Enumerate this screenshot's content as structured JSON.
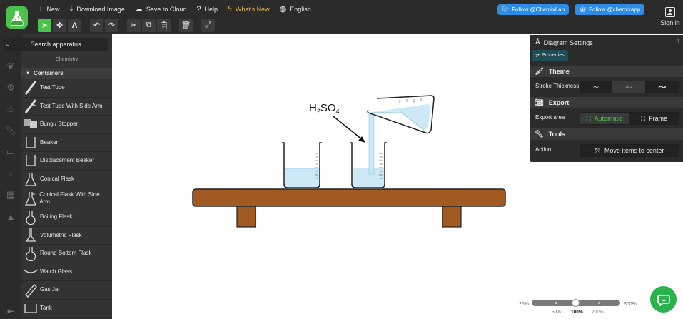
{
  "topbar": {
    "menu": [
      {
        "icon": "plus-icon",
        "label": "New"
      },
      {
        "icon": "download-icon",
        "label": "Download Image"
      },
      {
        "icon": "cloud-icon",
        "label": "Save to Cloud"
      },
      {
        "icon": "help-icon",
        "label": "Help"
      },
      {
        "icon": "bolt-icon",
        "label": "What's New"
      },
      {
        "icon": "globe-icon",
        "label": "English"
      }
    ],
    "follow_lab": "Follow @ChemixLab",
    "follow_app": "Follow @chemixapp",
    "signin": "Sign in"
  },
  "toolbar": {
    "icons": [
      "select-arrow-icon",
      "move-icon",
      "text-icon",
      "undo-icon",
      "redo-icon",
      "cut-icon",
      "copy-icon",
      "paste-icon",
      "delete-icon",
      "fit-screen-icon"
    ]
  },
  "rail": {
    "icons": [
      "flask-icon",
      "leaf-icon",
      "gear-icon",
      "flame-icon",
      "ruler-icon",
      "battery-icon",
      "drop-icon",
      "boxes-icon",
      "shapes-icon"
    ],
    "collapse_icon": "collapse-left-icon"
  },
  "sidebar": {
    "search_placeholder": "Search apparatus",
    "category": "Chemistry",
    "section": "Containers",
    "items": [
      {
        "label": "Test Tube"
      },
      {
        "label": "Test Tube With Side Arm"
      },
      {
        "label": "Bung / Stopper"
      },
      {
        "label": "Beaker"
      },
      {
        "label": "Displacement Beaker"
      },
      {
        "label": "Conical Flask"
      },
      {
        "label": "Conical Flask With Side Arm"
      },
      {
        "label": "Boiling Flask"
      },
      {
        "label": "Volumetric Flask"
      },
      {
        "label": "Round Bottom Flask"
      },
      {
        "label": "Watch Glass"
      },
      {
        "label": "Gas Jar"
      },
      {
        "label": "Tank"
      }
    ]
  },
  "canvas": {
    "label_main": "H",
    "label_sub1": "2",
    "label_mid": "SO",
    "label_sub2": "4",
    "liquid_color": "#cde9f6",
    "wood_color": "#a05a22"
  },
  "settings": {
    "title": "Diagram Settings",
    "tab": "Properties",
    "theme": "Theme",
    "stroke_label": "Stroke Thickness",
    "export": "Export",
    "export_area_label": "Export area",
    "export_auto": "Automatic",
    "export_frame": "Frame",
    "tools": "Tools",
    "action_label": "Action",
    "action_button": "Move items to center"
  },
  "zoom": {
    "min": "25%",
    "max": "300%",
    "ticks": [
      "50%",
      "100%",
      "200%"
    ],
    "current": "100%"
  },
  "colors": {
    "accent": "#4cc24c",
    "twitter": "#2d8de6",
    "whats_new": "#e5b64a"
  }
}
